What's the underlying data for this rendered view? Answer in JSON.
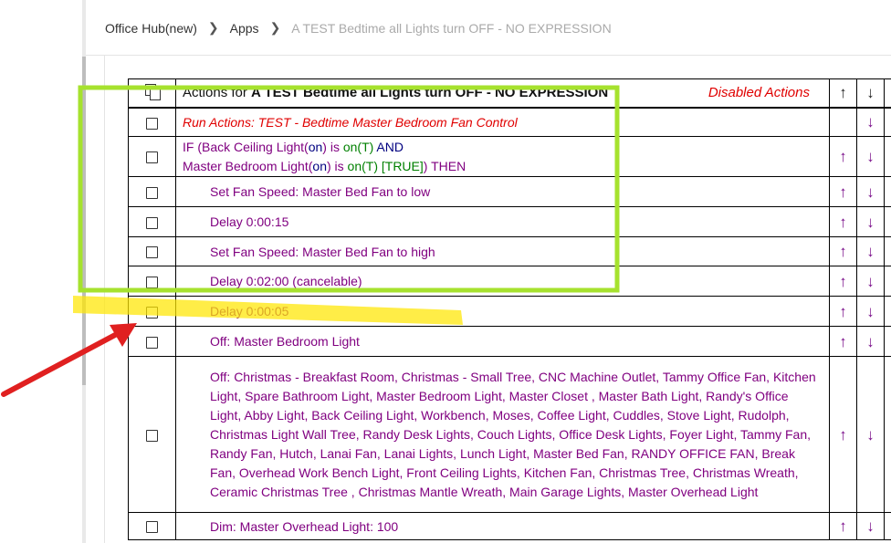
{
  "breadcrumb": {
    "items": [
      "Office Hub(new)",
      "Apps"
    ],
    "current": "A TEST Bedtime all Lights turn OFF - NO EXPRESSION"
  },
  "header": {
    "prefix": "Actions for ",
    "app_name": "A TEST Bedtime  all Lights turn OFF  - NO EXPRESSION",
    "disabled_actions": "Disabled Actions",
    "up": "↑",
    "down": "↓",
    "right": "→"
  },
  "rows": [
    {
      "text": "Run Actions: TEST - Bedtime  Master Bedroom Fan Control",
      "up": "",
      "down": "↓",
      "right": "→"
    },
    {
      "if_line1": [
        "IF (Back Ceiling Light(",
        "on",
        ") is ",
        "on(T)",
        "  AND"
      ],
      "if_line2": [
        "Master Bedroom Light(",
        "on",
        ") is ",
        "on(T) [TRUE]",
        ") THEN"
      ],
      "up": "↑",
      "down": "↓",
      "right": ""
    },
    {
      "text": "Set Fan Speed: Master Bed Fan to low",
      "up": "↑",
      "down": "↓",
      "right": "→"
    },
    {
      "text": "Delay 0:00:15",
      "up": "↑",
      "down": "↓",
      "right": ""
    },
    {
      "text": "Set Fan Speed: Master Bed Fan to high",
      "up": "↑",
      "down": "↓",
      "right": "→"
    },
    {
      "text": "Delay 0:02:00 (cancelable)",
      "up": "↑",
      "down": "↓",
      "right": ""
    },
    {
      "text": "Delay 0:00:05",
      "up": "↑",
      "down": "↓",
      "right": ""
    },
    {
      "text": "Off: Master Bedroom Light",
      "up": "↑",
      "down": "↓",
      "right": "→"
    },
    {
      "text": "Off: Christmas - Breakfast Room, Christmas - Small Tree, CNC Machine Outlet, Tammy Office Fan, Kitchen Light, Spare Bathroom Light, Master Bedroom Light, Master Closet , Master Bath Light, Randy's Office Light, Abby Light, Back Ceiling Light, Workbench, Moses, Coffee Light, Cuddles, Stove Light, Rudolph, Christmas Light Wall Tree, Randy Desk Lights, Couch Lights, Office Desk Lights, Foyer Light, Tammy Fan, Randy Fan, Hutch, Lanai Fan, Lanai Lights, Lunch Light, Master Bed Fan, RANDY OFFICE FAN, Break Fan, Overhead Work Bench Light, Front Ceiling Lights, Kitchen Fan, Christmas Tree, Christmas Wreath, Ceramic Christmas Tree , Christmas Mantle Wreath, Main Garage Lights, Master Overhead Light",
      "up": "↑",
      "down": "↓",
      "right": "→"
    },
    {
      "text": "Dim: Master Overhead Light: 100",
      "up": "↑",
      "down": "↓",
      "right": "→"
    }
  ],
  "annotations": {
    "box_color": "#a6e22e",
    "highlight_color": "#ffe600",
    "arrow_color": "#e02020"
  }
}
